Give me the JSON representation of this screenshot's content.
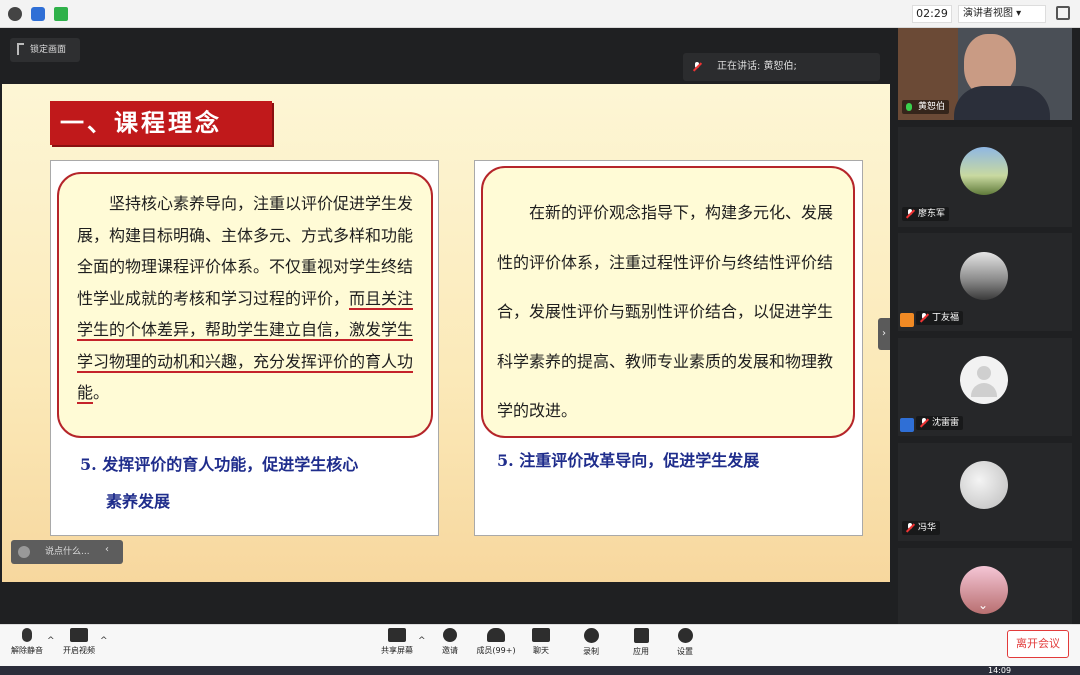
{
  "topbar": {
    "timer": "02:29",
    "view_selector": "演讲者视图 ▾",
    "icons": [
      "info-icon",
      "shield-icon",
      "signal-icon",
      "fullscreen-icon"
    ]
  },
  "share": {
    "lock_label": "锁定画面",
    "speaking_label": "正在讲话: 黄恕伯;"
  },
  "slide": {
    "title": "一、课程理念",
    "left": {
      "para_plain": "坚持核心素养导向，注重以评价促进学生发展，构建目标明确、主体多元、方式多样和功能全面的物理课程评价体系。不仅重视对学生终结性学业成就的考核和学习过程的评价，",
      "para_underlined": "而且关注学生的个体差异，帮助学生建立自信，激发学生学习物理的动机和兴趣，充分发挥评价的育人功能",
      "para_end": "。",
      "subhead_line1": "5. 发挥评价的育人功能，促进学生核心",
      "subhead_line2": "素养发展"
    },
    "right": {
      "para": "在新的评价观念指导下，构建多元化、发展性的评价体系，注重过程性评价与终结性评价结合，发展性评价与甄别性评价结合，以促进学生科学素养的提高、教师专业素质的发展和物理教学的改进。",
      "subhead": "5. 注重评价改革导向，促进学生发展"
    }
  },
  "chat": {
    "placeholder": "说点什么..."
  },
  "participants": [
    {
      "name": "黄恕伯",
      "mic": "on"
    },
    {
      "name": "廖东军",
      "mic": "off"
    },
    {
      "name": "丁友福",
      "mic": "off"
    },
    {
      "name": "沈雷雷",
      "mic": "off"
    },
    {
      "name": "冯华",
      "mic": "off"
    },
    {
      "name": "",
      "mic": "off"
    }
  ],
  "toolbar": {
    "unmute": "解除静音",
    "video": "开启视频",
    "share": "共享屏幕",
    "invite": "邀请",
    "members": "成员(99+)",
    "chat": "聊天",
    "record": "录制",
    "apps": "应用",
    "settings": "设置",
    "leave": "离开会议"
  },
  "taskbar": {
    "clock": "14:09"
  }
}
